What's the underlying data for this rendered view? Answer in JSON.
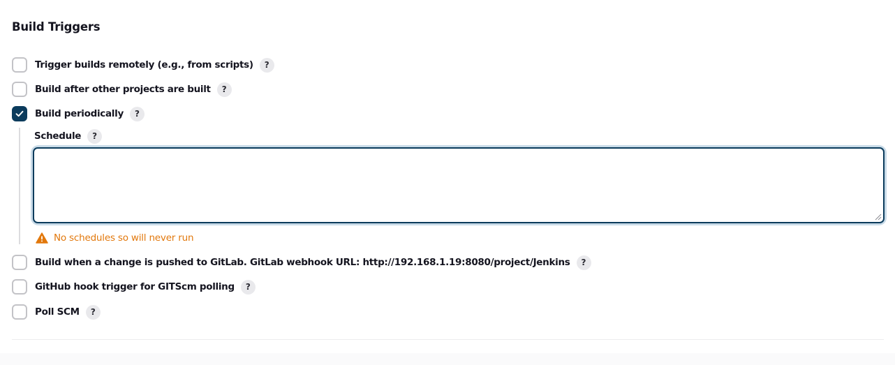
{
  "section": {
    "title": "Build Triggers"
  },
  "help_glyph": "?",
  "triggers": [
    {
      "label": "Trigger builds remotely (e.g., from scripts)",
      "checked": false
    },
    {
      "label": "Build after other projects are built",
      "checked": false
    },
    {
      "label": "Build periodically",
      "checked": true
    },
    {
      "label": "Build when a change is pushed to GitLab. GitLab webhook URL: http://192.168.1.19:8080/project/Jenkins",
      "checked": false
    },
    {
      "label": "GitHub hook trigger for GITScm polling",
      "checked": false
    },
    {
      "label": "Poll SCM",
      "checked": false
    }
  ],
  "schedule": {
    "label": "Schedule",
    "value": "",
    "warning": "No schedules so will never run"
  },
  "colors": {
    "accent": "#0b3b5c",
    "warning": "#e2780c",
    "checkbox_border": "#c3c3c7",
    "help_bg": "#e9e9ec"
  },
  "icons": {
    "check": "check-icon",
    "help": "help-icon",
    "warning": "warning-icon"
  }
}
